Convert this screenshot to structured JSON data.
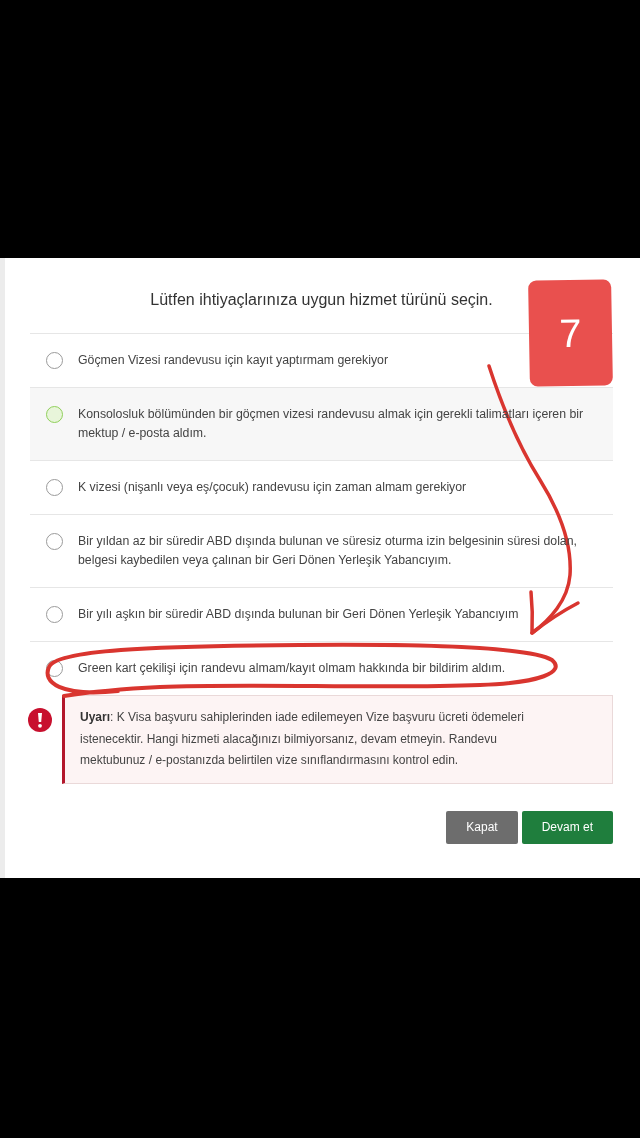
{
  "dialog": {
    "title": "Lütfen ihtiyaçlarınıza uygun hizmet türünü seçin.",
    "options": [
      {
        "label": "Göçmen Vizesi randevusu için kayıt yaptırmam gerekiyor",
        "selected": false,
        "hovered": false
      },
      {
        "label": "Konsolosluk bölümünden bir göçmen vizesi randevusu almak için gerekli talimatları içeren bir mektup / e-posta aldım.",
        "selected": false,
        "hovered": true
      },
      {
        "label": "K vizesi (nişanlı veya eş/çocuk) randevusu için zaman almam gerekiyor",
        "selected": false,
        "hovered": false
      },
      {
        "label": "Bir yıldan az bir süredir ABD dışında bulunan ve süresiz oturma izin belgesinin süresi dolan, belgesi kaybedilen veya çalınan bir Geri Dönen Yerleşik Yabancıyım.",
        "selected": false,
        "hovered": false
      },
      {
        "label": "Bir yılı aşkın bir süredir ABD dışında bulunan bir Geri Dönen Yerleşik Yabancıyım",
        "selected": false,
        "hovered": false
      },
      {
        "label": "Green kart çekilişi için randevu almam/kayıt olmam hakkında bir bildirim aldım.",
        "selected": false,
        "hovered": false
      }
    ],
    "warning": {
      "text": "**Uyarı**: K Visa başvuru sahiplerinden iade edilemeyen Vize başvuru ücreti ödemeleri istenecektir. Hangi hizmeti alacağınızı bilmiyorsanız, devam etmeyin. Randevu mektubunuz / e-postanızda belirtilen vize sınıflandırmasını kontrol edin."
    },
    "buttons": [
      {
        "label": "Kapat",
        "kind": "secondary"
      },
      {
        "label": "Devam et",
        "kind": "primary"
      }
    ]
  },
  "annotation": {
    "badge": "7"
  }
}
